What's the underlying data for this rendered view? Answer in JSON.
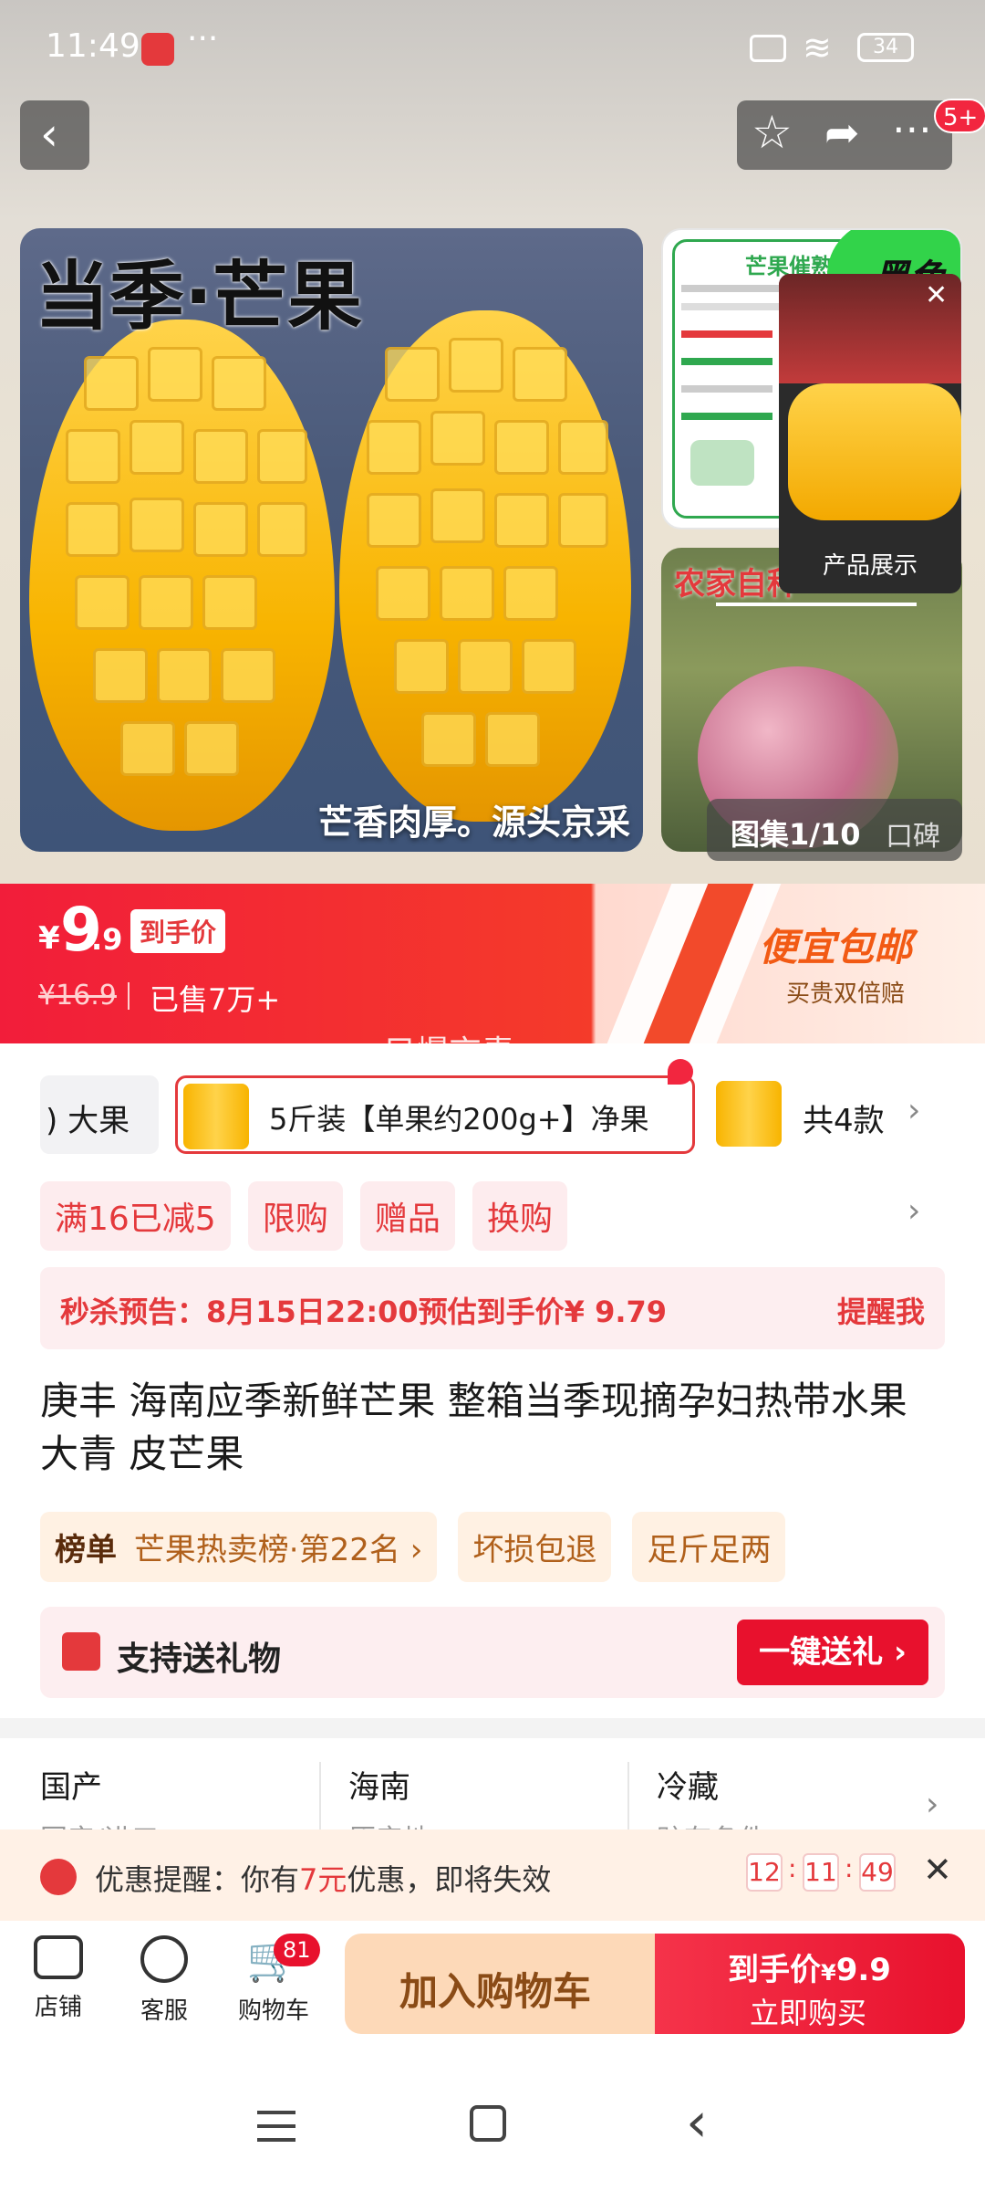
{
  "status_bar": {
    "time": "11:49",
    "dots": "···",
    "battery": "34"
  },
  "header": {
    "notification_badge": "5+"
  },
  "gallery": {
    "headline": "当季·芒果",
    "caption": "芒香肉厚。源头京采",
    "side_top_title": "芒果催熟",
    "side_top_badge": "黑色",
    "side_bottom_title": "农家自种",
    "video_label": "产品展示",
    "gallery_count": "图集1/10",
    "reviews": "口碑"
  },
  "price": {
    "currency": "¥",
    "integer": "9",
    "decimal": ".9",
    "price_tag": "到手价",
    "original": "¥16.9",
    "sold": "已售7万+",
    "promo_title": "便宜包邮",
    "promo_sub": "买贵双倍赔",
    "watermark": "只爆京青"
  },
  "variants": {
    "prev": ") 大果",
    "selected": "5斤装【单果约200g+】净果",
    "count": "共4款"
  },
  "promotions": [
    "满16已减5",
    "限购",
    "赠品",
    "换购"
  ],
  "flash_sale": {
    "text": "秒杀预告：8月15日22:00预估到手价¥ 9.79",
    "action": "提醒我"
  },
  "title": "庚丰 海南应季新鲜芒果 整箱当季现摘孕妇热带水果大青 皮芒果",
  "ranking": {
    "label": "榜单",
    "text": "芒果热卖榜·第22名 ›"
  },
  "tags": [
    "坏损包退",
    "足斤足两"
  ],
  "gift": {
    "text": "支持送礼物",
    "button": "一键送礼 ›"
  },
  "specs": [
    "国产",
    "海南",
    "冷藏"
  ],
  "specs_sub": [
    "国产/进口",
    "原产地",
    "贮存条件"
  ],
  "coupon_alert": {
    "prefix": "优惠提醒：你有",
    "amount": "7元",
    "suffix": "优惠，即将失效",
    "hh": "12",
    "mm": "11",
    "ss": "49"
  },
  "bottom_nav": {
    "store": "店铺",
    "service": "客服",
    "cart": "购物车",
    "cart_badge": "81"
  },
  "actions": {
    "add_cart": "加入购物车",
    "buy_price_label": "到手价",
    "buy_currency": "¥",
    "buy_price": "9.9",
    "buy_now": "立即购买"
  },
  "colors": {
    "brand_red": "#e4393c",
    "accent_orange": "#fbd9b8"
  }
}
